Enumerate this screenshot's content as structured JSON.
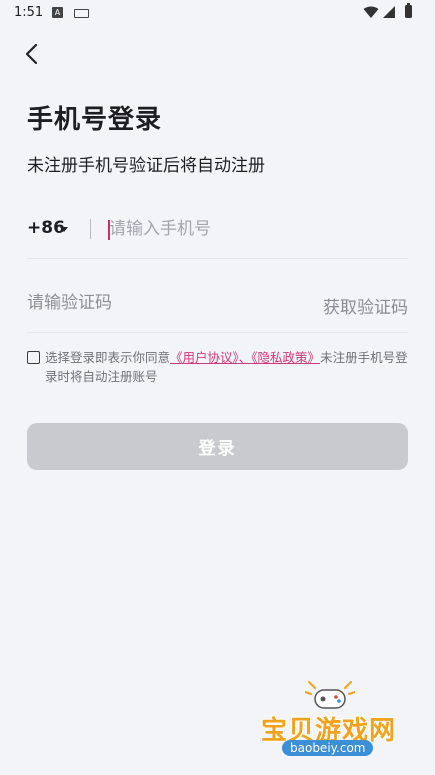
{
  "status_bar": {
    "time": "1:51",
    "notification_icon": "A"
  },
  "header": {
    "back_icon": "chevron-left-icon"
  },
  "page": {
    "title": "手机号登录",
    "subtitle": "未注册手机号验证后将自动注册"
  },
  "phone": {
    "country_code": "+86",
    "placeholder": "请输入手机号",
    "value": ""
  },
  "verification": {
    "placeholder": "请输验证码",
    "value": "",
    "get_code_label": "获取验证码"
  },
  "agreement": {
    "checked": false,
    "prefix": "选择登录即表示你同意",
    "user_agreement": "《用户协议》",
    "separator": "、",
    "privacy_policy": "《隐私政策》",
    "suffix": "未注册手机号登录时将自动注册账号"
  },
  "login_button": {
    "label": "登录"
  },
  "watermark": {
    "title": "宝贝游戏网",
    "url": "baobeiy.com"
  },
  "colors": {
    "background": "#f3f4f8",
    "accent": "#d0387c",
    "button_disabled": "#c9cacf",
    "watermark_orange": "#f2a21c",
    "watermark_blue": "#3b8fd6"
  }
}
